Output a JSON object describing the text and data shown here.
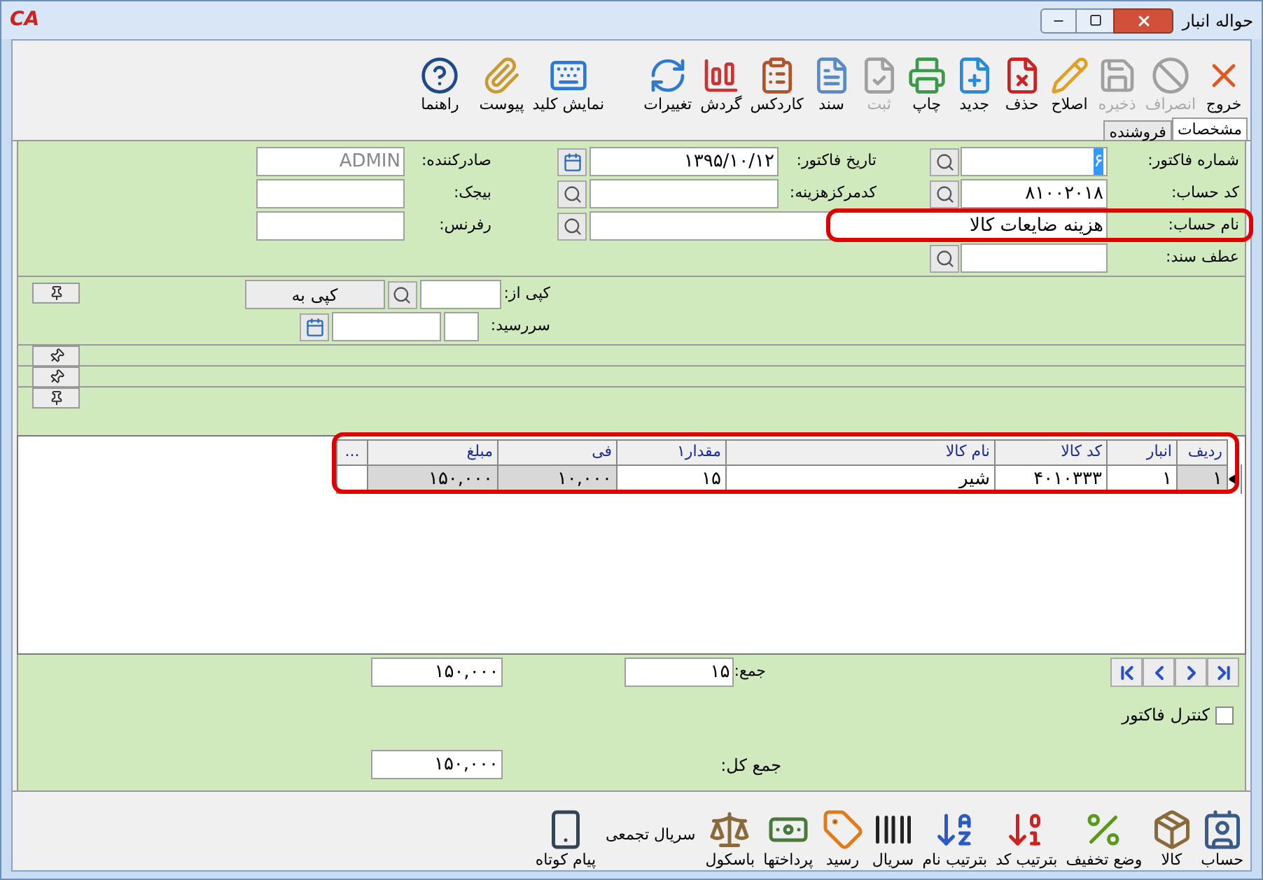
{
  "window": {
    "logo": "CA",
    "title": "حواله انبار"
  },
  "toolbar": [
    {
      "label": "خروج",
      "disabled": false
    },
    {
      "label": "انصراف",
      "disabled": true
    },
    {
      "label": "ذخیره",
      "disabled": true
    },
    {
      "label": "اصلاح",
      "disabled": false
    },
    {
      "label": "حذف",
      "disabled": false
    },
    {
      "label": "جدید",
      "disabled": false
    },
    {
      "label": "چاپ",
      "disabled": false
    },
    {
      "label": "ثبت",
      "disabled": true
    },
    {
      "label": "سند",
      "disabled": false
    },
    {
      "label": "کاردکس",
      "disabled": false
    },
    {
      "label": "گردش",
      "disabled": false
    },
    {
      "label": "تغییرات",
      "disabled": false
    },
    {
      "label": "نمایش کلید",
      "disabled": false
    },
    {
      "label": "پیوست",
      "disabled": false
    },
    {
      "label": "راهنما",
      "disabled": false
    }
  ],
  "tabs": [
    {
      "label": "مشخصات",
      "selected": true
    },
    {
      "label": "فروشنده",
      "selected": false
    }
  ],
  "fields": {
    "invoice_number": {
      "label": "شماره فاکتور:",
      "value": "۶",
      "text_selected": true
    },
    "invoice_date": {
      "label": "تاریخ فاکتور:",
      "value": "۱۳۹۵/۱۰/۱۲"
    },
    "issuer": {
      "label": "صادرکننده:",
      "value": "ADMIN",
      "disabled": true
    },
    "account_code": {
      "label": "کد حساب:",
      "value": "۸۱۰۰۲۰۱۸"
    },
    "cost_center_code": {
      "label": "کدمرکزهزینه:"
    },
    "budget": {
      "label": "بیجک:"
    },
    "account_name": {
      "label": "نام حساب:",
      "value": "هزینه ضایعات کالا",
      "highlighted": true
    },
    "reference": {
      "label": "رفرنس:"
    },
    "doc_ref": {
      "label": "عطف سند:"
    }
  },
  "copy": {
    "copy_from": {
      "label": "کپی از:"
    },
    "copy_to_button": "کپی به",
    "due_date": {
      "label": "سررسید:"
    }
  },
  "table": {
    "highlighted": true,
    "columns": [
      {
        "label": "ردیف",
        "readonly": true
      },
      {
        "label": "انبار",
        "readonly": false
      },
      {
        "label": "کد کالا",
        "readonly": false
      },
      {
        "label": "نام کالا",
        "readonly": false
      },
      {
        "label": "مقدار۱",
        "readonly": false
      },
      {
        "label": "فی",
        "readonly": true
      },
      {
        "label": "مبلغ",
        "readonly": true
      },
      {
        "label": "...",
        "readonly": false
      }
    ],
    "rows": [
      {
        "selected": true,
        "cells": [
          "۱",
          "۱",
          "۴۰۱۰۳۳۳",
          "شیر",
          "۱۵",
          "۱۰,۰۰۰",
          "۱۵۰,۰۰۰"
        ]
      }
    ]
  },
  "totals": {
    "sum_label": "جمع:",
    "sum_quantity": "۱۵",
    "sum_amount": "۱۵۰,۰۰۰",
    "grand_total_label": "جمع کل:",
    "grand_total": "۱۵۰,۰۰۰"
  },
  "invoice_control": {
    "label": "کنترل فاکتور",
    "checked": false
  },
  "bottom_toolbar": [
    {
      "label": "حساب",
      "kind": "icon"
    },
    {
      "label": "کالا",
      "kind": "icon"
    },
    {
      "label": "وضع تخفیف",
      "kind": "icon"
    },
    {
      "label": "بترتیب کد",
      "kind": "icon"
    },
    {
      "label": "بترتیب نام",
      "kind": "icon"
    },
    {
      "label": "سریال",
      "kind": "icon"
    },
    {
      "label": "رسید",
      "kind": "icon"
    },
    {
      "label": "پرداختها",
      "kind": "icon"
    },
    {
      "label": "باسکول",
      "kind": "icon"
    },
    {
      "label": "سریال تجمعی",
      "kind": "text"
    },
    {
      "label": "پیام کوتاه",
      "kind": "icon"
    }
  ]
}
